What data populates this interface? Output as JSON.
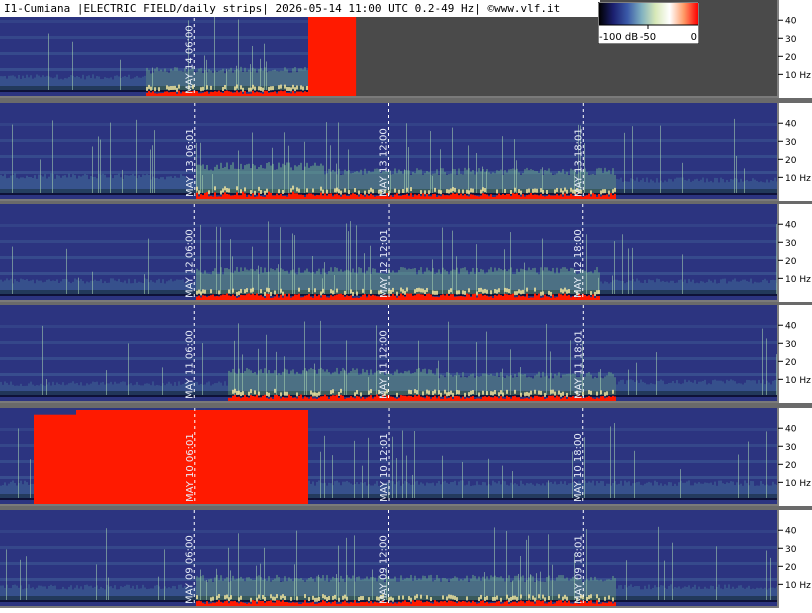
{
  "title": "I1-Cumiana |ELECTRIC FIELD/daily strips| 2026-05-14 11:00 UTC 0.2-49 Hz| ©www.vlf.it",
  "colorbar": {
    "labels": [
      "-100 dB",
      "-50",
      "0"
    ],
    "stops": [
      "#000000",
      "#1b1f6e",
      "#3a59a8",
      "#7fb0c0",
      "#d8e8b8",
      "#ffffff",
      "#ff9a66",
      "#ff0000"
    ]
  },
  "colors": {
    "background_band": "#2a2f7a",
    "grey_fill": "#4a4a4a",
    "hot": "#ff1a00",
    "guide": "#ffffff"
  },
  "chart_data": {
    "type": "heatmap",
    "title": "I1-Cumiana |ELECTRIC FIELD/daily strips| 2026-05-14 11:00 UTC 0.2-49 Hz| ©www.vlf.it",
    "y_unit": "Hz",
    "ylim": [
      0.2,
      49
    ],
    "y_ticks": [
      10,
      20,
      30,
      40
    ],
    "y_tick_labels": [
      "10 Hz",
      "20",
      "30",
      "40"
    ],
    "color_scale_db": [
      -100,
      0
    ],
    "time_markers": [
      "06:00",
      "12:00",
      "18:00"
    ],
    "strips": [
      {
        "day": "MAY 14",
        "markers": [
          {
            "label": "MAY 14  06:00",
            "time": "06:00"
          }
        ],
        "data_until": "11:00",
        "activity": [
          {
            "t_start": "00:00",
            "t_end": "04:30",
            "level": 0.15
          },
          {
            "t_start": "04:30",
            "t_end": "09:30",
            "level": 0.35
          },
          {
            "t_start": "09:30",
            "t_end": "11:00",
            "level": 0.9
          }
        ]
      },
      {
        "day": "MAY 13",
        "markers": [
          {
            "label": "MAY 13  06:01",
            "time": "06:01"
          },
          {
            "label": "MAY 13  12:00",
            "time": "12:00"
          },
          {
            "label": "MAY 13  18:01",
            "time": "18:01"
          }
        ],
        "activity": [
          {
            "t_start": "00:00",
            "t_end": "06:00",
            "level": 0.25
          },
          {
            "t_start": "06:00",
            "t_end": "10:00",
            "level": 0.55
          },
          {
            "t_start": "10:00",
            "t_end": "19:00",
            "level": 0.4
          },
          {
            "t_start": "19:00",
            "t_end": "24:00",
            "level": 0.15
          }
        ]
      },
      {
        "day": "MAY 12",
        "markers": [
          {
            "label": "MAY 12  06:00",
            "time": "06:00"
          },
          {
            "label": "MAY 12  12:01",
            "time": "12:01"
          },
          {
            "label": "MAY 12  18:00",
            "time": "18:00"
          }
        ],
        "activity": [
          {
            "t_start": "00:00",
            "t_end": "06:00",
            "level": 0.15
          },
          {
            "t_start": "06:00",
            "t_end": "18:30",
            "level": 0.45
          },
          {
            "t_start": "18:30",
            "t_end": "24:00",
            "level": 0.15
          }
        ]
      },
      {
        "day": "MAY 11",
        "markers": [
          {
            "label": "MAY 11  06:00",
            "time": "06:00"
          },
          {
            "label": "MAY 11  12:00",
            "time": "12:00"
          },
          {
            "label": "MAY 11  18:01",
            "time": "18:01"
          }
        ],
        "activity": [
          {
            "t_start": "00:00",
            "t_end": "07:00",
            "level": 0.1
          },
          {
            "t_start": "07:00",
            "t_end": "13:30",
            "level": 0.45
          },
          {
            "t_start": "13:30",
            "t_end": "19:00",
            "level": 0.35
          },
          {
            "t_start": "19:00",
            "t_end": "24:00",
            "level": 0.15
          }
        ]
      },
      {
        "day": "MAY 10",
        "markers": [
          {
            "label": "MAY 10  06:01",
            "time": "06:01"
          },
          {
            "label": "MAY 10  12:01",
            "time": "12:01"
          },
          {
            "label": "MAY 10  18:00",
            "time": "18:00"
          }
        ],
        "activity": [
          {
            "t_start": "00:00",
            "t_end": "01:00",
            "level": 0.2
          },
          {
            "t_start": "01:00",
            "t_end": "02:20",
            "level": 0.95
          },
          {
            "t_start": "02:20",
            "t_end": "09:30",
            "level": 1.0
          },
          {
            "t_start": "09:30",
            "t_end": "24:00",
            "level": 0.2
          }
        ]
      },
      {
        "day": "MAY 09",
        "markers": [
          {
            "label": "MAY 09  06:00",
            "time": "06:00"
          },
          {
            "label": "MAY 09  12:00",
            "time": "12:00"
          },
          {
            "label": "MAY 09  18:01",
            "time": "18:01"
          }
        ],
        "activity": [
          {
            "t_start": "00:00",
            "t_end": "06:00",
            "level": 0.15
          },
          {
            "t_start": "06:00",
            "t_end": "19:00",
            "level": 0.4
          },
          {
            "t_start": "19:00",
            "t_end": "24:00",
            "level": 0.15
          }
        ]
      }
    ]
  }
}
